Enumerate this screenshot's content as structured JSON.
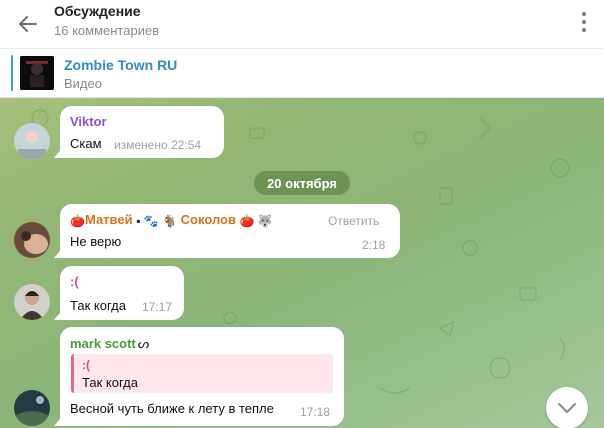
{
  "header": {
    "title": "Обсуждение",
    "subtitle": "16 комментариев"
  },
  "pinned": {
    "title": "Zombie Town RU",
    "subtitle": "Видео"
  },
  "date_separator": "20 октября",
  "messages": [
    {
      "author": "Viktor",
      "author_color": "#8e4fd1",
      "text": "Скам",
      "time": "изменено 22:54"
    },
    {
      "author_prefix": "🍅",
      "author": "Матвей",
      "author_mid": "▪ 🐾 🐐",
      "author2": "Соколов",
      "author_suffix": "🍅 🐺",
      "author_color": "#d9711e",
      "text": "Не верю",
      "time": "2:18",
      "reply_label": "Ответить"
    },
    {
      "author": ":(",
      "author_color": "#d64e78",
      "text": "Так когда",
      "time": "17:17"
    },
    {
      "author": "mark scott",
      "author_suffix": "ᔕ",
      "author_color": "#4a9a3a",
      "quote_author": ":(",
      "quote_text": "Так когда",
      "text": "Весной чуть ближе к лету в тепле",
      "time": "17:18"
    }
  ],
  "colors": {
    "accent": "#2e8bc8",
    "chat_bg": "#93b673"
  }
}
